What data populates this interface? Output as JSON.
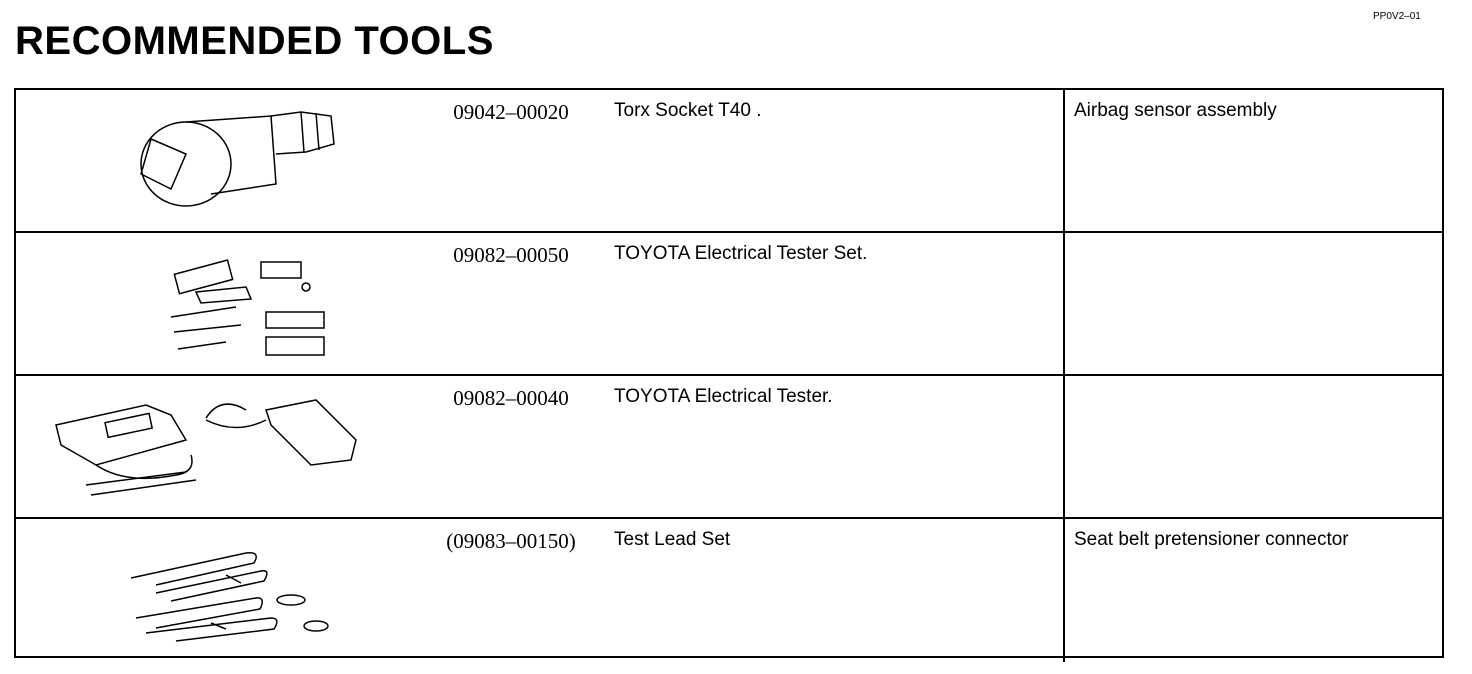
{
  "page": {
    "title": "RECOMMENDED TOOLS",
    "code": "PP0V2–01"
  },
  "tools": [
    {
      "part_no": "09042–00020",
      "name": "Torx Socket T40 .",
      "note": "Airbag sensor assembly",
      "illustration": "torx-socket-illustration"
    },
    {
      "part_no": "09082–00050",
      "name": "TOYOTA Electrical Tester Set.",
      "note": "",
      "illustration": "tester-set-illustration"
    },
    {
      "part_no": "09082–00040",
      "name": "TOYOTA Electrical Tester.",
      "note": "",
      "illustration": "electrical-tester-illustration"
    },
    {
      "part_no": "(09083–00150)",
      "name": "Test Lead Set",
      "note": "Seat belt pretensioner connector",
      "illustration": "test-lead-set-illustration"
    }
  ]
}
